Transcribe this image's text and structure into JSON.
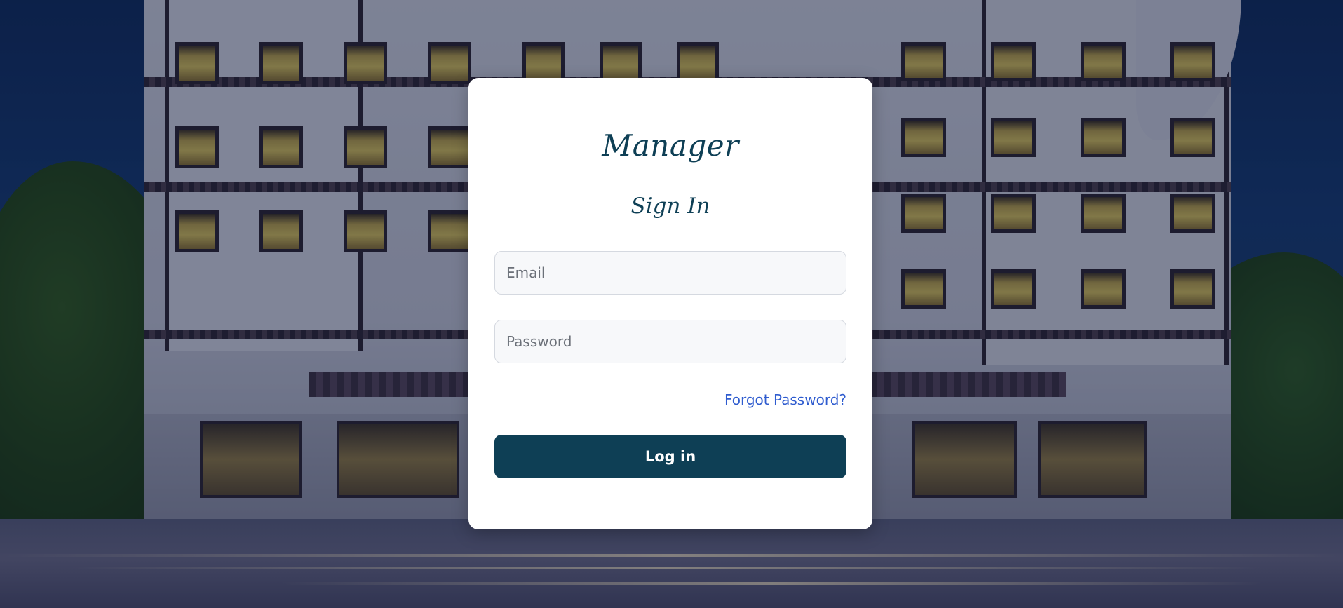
{
  "window": {
    "title": "Manager"
  },
  "login_card": {
    "app_title": "Manager",
    "heading": "Sign In",
    "email": {
      "value": "",
      "placeholder": "Email"
    },
    "password": {
      "value": "",
      "placeholder": "Password"
    },
    "forgot_password_label": "Forgot Password?",
    "login_button_label": "Log in"
  },
  "colors": {
    "primary": "#0e3f55",
    "link": "#2f5ccf",
    "card_background": "#ffffff",
    "field_background": "#f7f8fa"
  }
}
